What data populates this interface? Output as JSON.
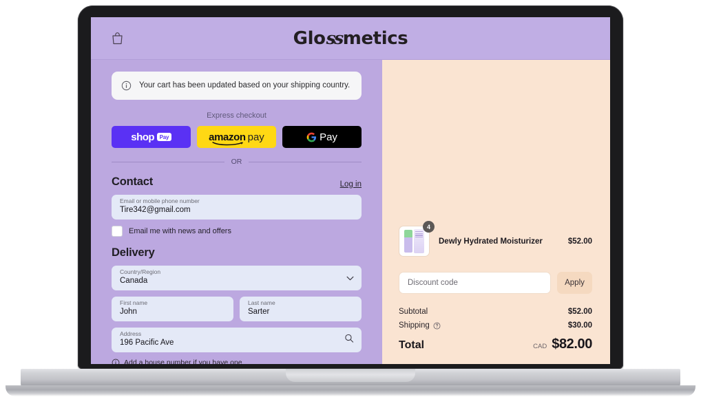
{
  "header": {
    "brand_prefix": "Glo",
    "brand_swash": "ss",
    "brand_suffix": "metics",
    "bag_icon": "shopping-bag-icon"
  },
  "notice": {
    "icon": "info-circle-icon",
    "text": "Your cart has been updated based on your shipping country."
  },
  "express": {
    "label": "Express checkout",
    "buttons": [
      {
        "id": "shop-pay",
        "word": "shop",
        "badge": "Pay"
      },
      {
        "id": "amazon-pay",
        "word": "amazon",
        "suffix": "pay"
      },
      {
        "id": "google-pay",
        "word": "Pay"
      }
    ],
    "divider_text": "OR"
  },
  "contact": {
    "title": "Contact",
    "login_label": "Log in",
    "email_field": {
      "label": "Email or mobile phone number",
      "value": "Tire342@gmail.com"
    },
    "newsletter_label": "Email me with news and offers",
    "newsletter_checked": false
  },
  "delivery": {
    "title": "Delivery",
    "country": {
      "label": "Country/Region",
      "value": "Canada",
      "icon": "chevron-down-icon"
    },
    "first_name": {
      "label": "First name",
      "value": "John"
    },
    "last_name": {
      "label": "Last name",
      "value": "Sarter"
    },
    "address": {
      "label": "Address",
      "value": "196 Pacific Ave",
      "icon": "search-icon"
    },
    "helper": {
      "icon": "info-circle-icon",
      "text": "Add a house number if you have one"
    }
  },
  "summary": {
    "item": {
      "name": "Dewly Hydrated Moisturizer",
      "price": "$52.00",
      "quantity": "4"
    },
    "discount": {
      "placeholder": "Discount code",
      "apply_label": "Apply"
    },
    "subtotal": {
      "label": "Subtotal",
      "value": "$52.00"
    },
    "shipping": {
      "label": "Shipping",
      "icon": "help-circle-icon",
      "value": "$30.00"
    },
    "total": {
      "label": "Total",
      "currency": "CAD",
      "value": "$82.00"
    }
  },
  "colors": {
    "header_purple": "#C0AEE4",
    "panel_purple": "#BCA8E0",
    "panel_peach": "#FAE4D2",
    "field_blue": "#E4E9F7",
    "shop_pay": "#5A31F4",
    "amazon_pay": "#FFD814",
    "google_pay": "#000000",
    "apply_button": "#F5D9C0"
  }
}
